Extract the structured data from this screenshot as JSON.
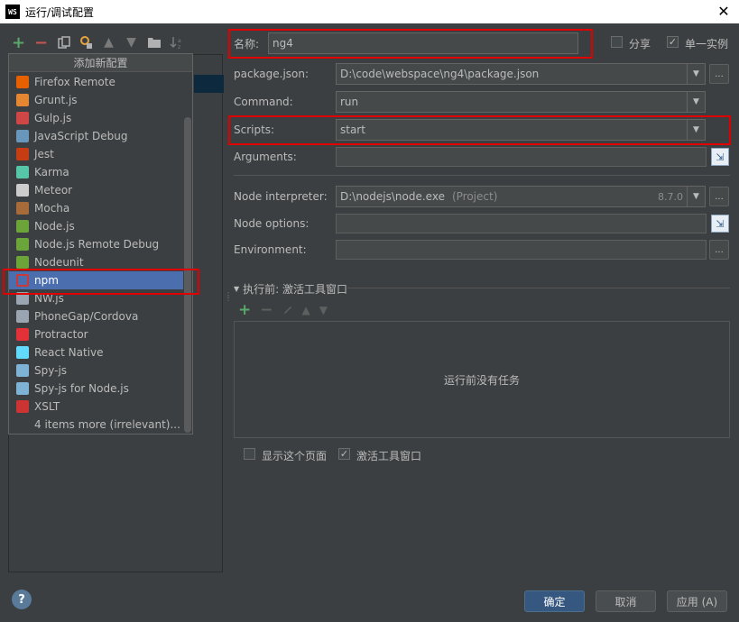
{
  "window": {
    "app_badge": "WS",
    "title": "运行/调试配置",
    "close_glyph": "✕"
  },
  "left_toolbar": {
    "icons": [
      "add-icon",
      "remove-icon",
      "copy-icon",
      "edit-defaults-icon",
      "move-up-icon",
      "move-down-icon",
      "folder-icon",
      "sort-icon"
    ]
  },
  "popup": {
    "header": "添加新配置",
    "items": [
      {
        "label": "Firefox Remote",
        "icon": "firefox-icon",
        "color": "#e66000"
      },
      {
        "label": "Grunt.js",
        "icon": "grunt-icon",
        "color": "#e48632"
      },
      {
        "label": "Gulp.js",
        "icon": "gulp-icon",
        "color": "#cf4647"
      },
      {
        "label": "JavaScript Debug",
        "icon": "javascript-debug-icon",
        "color": "#6897bb"
      },
      {
        "label": "Jest",
        "icon": "jest-icon",
        "color": "#c63d14"
      },
      {
        "label": "Karma",
        "icon": "karma-icon",
        "color": "#56c5a8"
      },
      {
        "label": "Meteor",
        "icon": "meteor-icon",
        "color": "#cccccc"
      },
      {
        "label": "Mocha",
        "icon": "mocha-icon",
        "color": "#a76b3a"
      },
      {
        "label": "Node.js",
        "icon": "nodejs-icon",
        "color": "#6ba539"
      },
      {
        "label": "Node.js Remote Debug",
        "icon": "nodejs-remote-debug-icon",
        "color": "#6ba539"
      },
      {
        "label": "Nodeunit",
        "icon": "nodeunit-icon",
        "color": "#6ba539"
      },
      {
        "label": "npm",
        "icon": "npm-icon",
        "color": "#cb3837"
      },
      {
        "label": "NW.js",
        "icon": "nwjs-icon",
        "color": "#9aa5b1"
      },
      {
        "label": "PhoneGap/Cordova",
        "icon": "phonegap-icon",
        "color": "#9aa5b1"
      },
      {
        "label": "Protractor",
        "icon": "protractor-icon",
        "color": "#e23237"
      },
      {
        "label": "React Native",
        "icon": "react-native-icon",
        "color": "#61dafb"
      },
      {
        "label": "Spy-js",
        "icon": "spy-js-icon",
        "color": "#7fb3d5"
      },
      {
        "label": "Spy-js for Node.js",
        "icon": "spy-js-node-icon",
        "color": "#7fb3d5"
      },
      {
        "label": "XSLT",
        "icon": "xslt-icon",
        "color": "#cc3333"
      },
      {
        "label": "4 items more (irrelevant)...",
        "icon": "",
        "color": ""
      }
    ]
  },
  "form": {
    "name_label": "名称:",
    "name_value": "ng4",
    "share_label": "分享",
    "share_checked": false,
    "single_instance_label": "单一实例",
    "single_instance_checked": true,
    "package_json_label": "package.json:",
    "package_json_value": "D:\\code\\webspace\\ng4\\package.json",
    "command_label": "Command:",
    "command_value": "run",
    "scripts_label": "Scripts:",
    "scripts_value": "start",
    "arguments_label": "Arguments:",
    "node_interpreter_label": "Node interpreter:",
    "node_interpreter_value": "D:\\nodejs\\node.exe",
    "node_interpreter_hint": "(Project)",
    "node_version": "8.7.0",
    "node_options_label": "Node options:",
    "environment_label": "Environment:",
    "dots": "...",
    "combo_arrow": "▼"
  },
  "before_launch": {
    "title": "执行前: 激活工具窗口",
    "empty_text": "运行前没有任务",
    "toolbar_icons": [
      "add-icon",
      "remove-icon",
      "edit-icon",
      "move-up-icon",
      "move-down-icon"
    ]
  },
  "footer_options": {
    "show_page_label": "显示这个页面",
    "show_page_checked": false,
    "activate_window_label": "激活工具窗口",
    "activate_window_checked": true
  },
  "buttons": {
    "ok": "确定",
    "cancel": "取消",
    "apply": "应用 (A)",
    "help": "?"
  },
  "colors": {
    "accent_selected": "#4b6eaf",
    "highlight_red": "#e10000",
    "primary_button": "#365880"
  }
}
